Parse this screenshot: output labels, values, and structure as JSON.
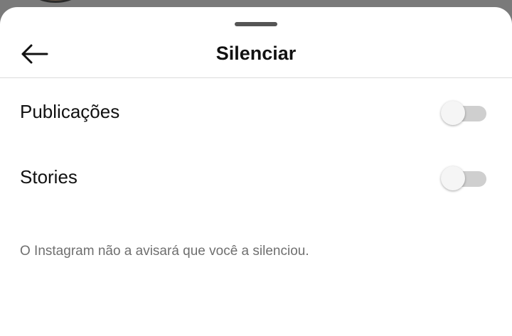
{
  "sheet": {
    "title": "Silenciar",
    "back_icon": "arrow-left-icon"
  },
  "options": [
    {
      "label": "Publicações",
      "enabled": false
    },
    {
      "label": "Stories",
      "enabled": false
    }
  ],
  "note": "O Instagram não a avisará que você a silenciou.",
  "colors": {
    "background_overlay": "#7a7a7a",
    "sheet": "#ffffff",
    "toggle_track_off": "#cfcfcf",
    "toggle_knob": "#f5f5f5",
    "note_text": "#6f6f6f"
  }
}
